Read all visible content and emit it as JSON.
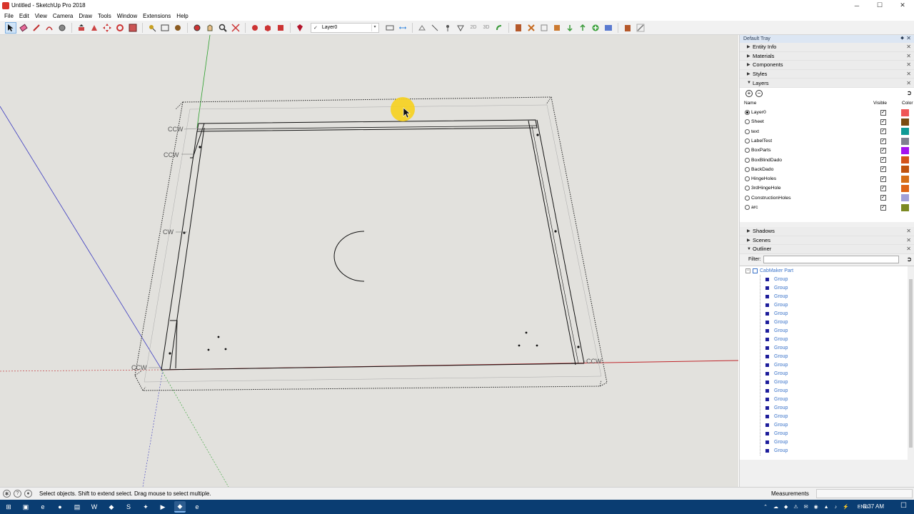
{
  "window": {
    "title": "Untitled - SketchUp Pro 2018",
    "controls": {
      "min": "─",
      "max": "☐",
      "close": "✕"
    }
  },
  "menu": [
    "File",
    "Edit",
    "View",
    "Camera",
    "Draw",
    "Tools",
    "Window",
    "Extensions",
    "Help"
  ],
  "toolbar": {
    "layer_check": "✓",
    "layer_value": "Layer0",
    "dropdown_glyph": "▾",
    "icons": [
      "select-icon",
      "eraser-icon",
      "pencil-icon",
      "arc-icon",
      "circle-icon",
      "move-icon",
      "pushpull-icon",
      "rotate-icon",
      "scale-icon",
      "offset-icon",
      "tape-icon",
      "text-icon",
      "paint-icon",
      "orbit-icon",
      "pan-icon",
      "zoom-icon",
      "zoom-extents-icon",
      "warehouse-icon",
      "components-icon",
      "extension-icon",
      "ruby-icon"
    ],
    "icons2": [
      "section-icon",
      "dimension-icon",
      "protractor-icon",
      "axes-icon",
      "label-icon",
      "2d-icon",
      "3d-icon",
      "undo-icon",
      "box-icon",
      "hinge-icon",
      "part-icon",
      "export-icon",
      "import-icon",
      "add-icon",
      "window-icon",
      "folder-icon",
      "edit-icon"
    ]
  },
  "viewport": {
    "labels": [
      "CCW",
      "CCW",
      "CW",
      "CCW",
      "CCW"
    ],
    "colors": {
      "background": "#e2e1dd",
      "red_axis": "#c0262b",
      "green_axis": "#2aa02a",
      "blue_axis": "#3a3ac0",
      "cursor_highlight": "#f7d21d"
    }
  },
  "tray": {
    "title": "Default Tray",
    "pin": "⬥",
    "close": "✕",
    "panels_top": [
      {
        "label": "Entity Info",
        "expanded": false
      },
      {
        "label": "Materials",
        "expanded": false
      },
      {
        "label": "Components",
        "expanded": false
      },
      {
        "label": "Styles",
        "expanded": false
      },
      {
        "label": "Layers",
        "expanded": true
      }
    ],
    "layers": {
      "add": "+",
      "remove": "−",
      "detail": "➲",
      "columns": {
        "name": "Name",
        "visible": "Visible",
        "color": "Color"
      },
      "rows": [
        {
          "name": "Layer0",
          "active": true,
          "visible": true,
          "color": "#f05656"
        },
        {
          "name": "Sheet",
          "active": false,
          "visible": true,
          "color": "#7a4b10"
        },
        {
          "name": "text",
          "active": false,
          "visible": true,
          "color": "#0f9a96"
        },
        {
          "name": "LabelTest",
          "active": false,
          "visible": true,
          "color": "#7f8090"
        },
        {
          "name": "BoxParts",
          "active": false,
          "visible": true,
          "color": "#a312f0"
        },
        {
          "name": "BoxBlindDado",
          "active": false,
          "visible": true,
          "color": "#d4531a"
        },
        {
          "name": "BackDado",
          "active": false,
          "visible": true,
          "color": "#c0530f"
        },
        {
          "name": "HingeHoles",
          "active": false,
          "visible": true,
          "color": "#d66f18"
        },
        {
          "name": "3rdHingeHole",
          "active": false,
          "visible": true,
          "color": "#de6517"
        },
        {
          "name": "ConstructionHoles",
          "active": false,
          "visible": true,
          "color": "#a1a0d8"
        },
        {
          "name": "arc",
          "active": false,
          "visible": true,
          "color": "#7c8a22"
        }
      ]
    },
    "panels_bottom": [
      {
        "label": "Shadows",
        "expanded": false
      },
      {
        "label": "Scenes",
        "expanded": false
      },
      {
        "label": "Outliner",
        "expanded": true
      }
    ],
    "outliner": {
      "filter_label": "Filter:",
      "filter_value": "",
      "detail": "➲",
      "collapse": "−",
      "root": "CabMaker Part",
      "children": [
        "Group",
        "Group",
        "Group",
        "Group",
        "Group",
        "Group",
        "Group",
        "Group",
        "Group",
        "Group",
        "Group",
        "Group",
        "Group",
        "Group",
        "Group",
        "Group",
        "Group",
        "Group",
        "Group",
        "Group",
        "Group"
      ]
    }
  },
  "status": {
    "icons": {
      "geo": "✱",
      "info": "?",
      "user": "●"
    },
    "message": "Select objects. Shift to extend select. Drag mouse to select multiple.",
    "measurements_label": "Measurements",
    "measurements_value": ""
  },
  "taskbar": {
    "start": "⊞",
    "apps": [
      "explorer-icon",
      "edge-icon",
      "chrome-icon",
      "store-icon",
      "word-icon",
      "sketchup-icon",
      "skype-icon",
      "maps-icon",
      "photos-icon",
      "sketchup-active-icon",
      "ie-icon"
    ],
    "app_glyphs": [
      "▣",
      "e",
      "●",
      "▤",
      "W",
      "◆",
      "S",
      "✦",
      "▶",
      "◆",
      "e"
    ],
    "tray_glyphs": [
      "⌃",
      "☁",
      "◆",
      "⚠",
      "✉",
      "◉",
      "▲",
      "♪",
      "⚡"
    ],
    "lang": "ENG",
    "time": "5:37 AM",
    "notify": "☐"
  }
}
